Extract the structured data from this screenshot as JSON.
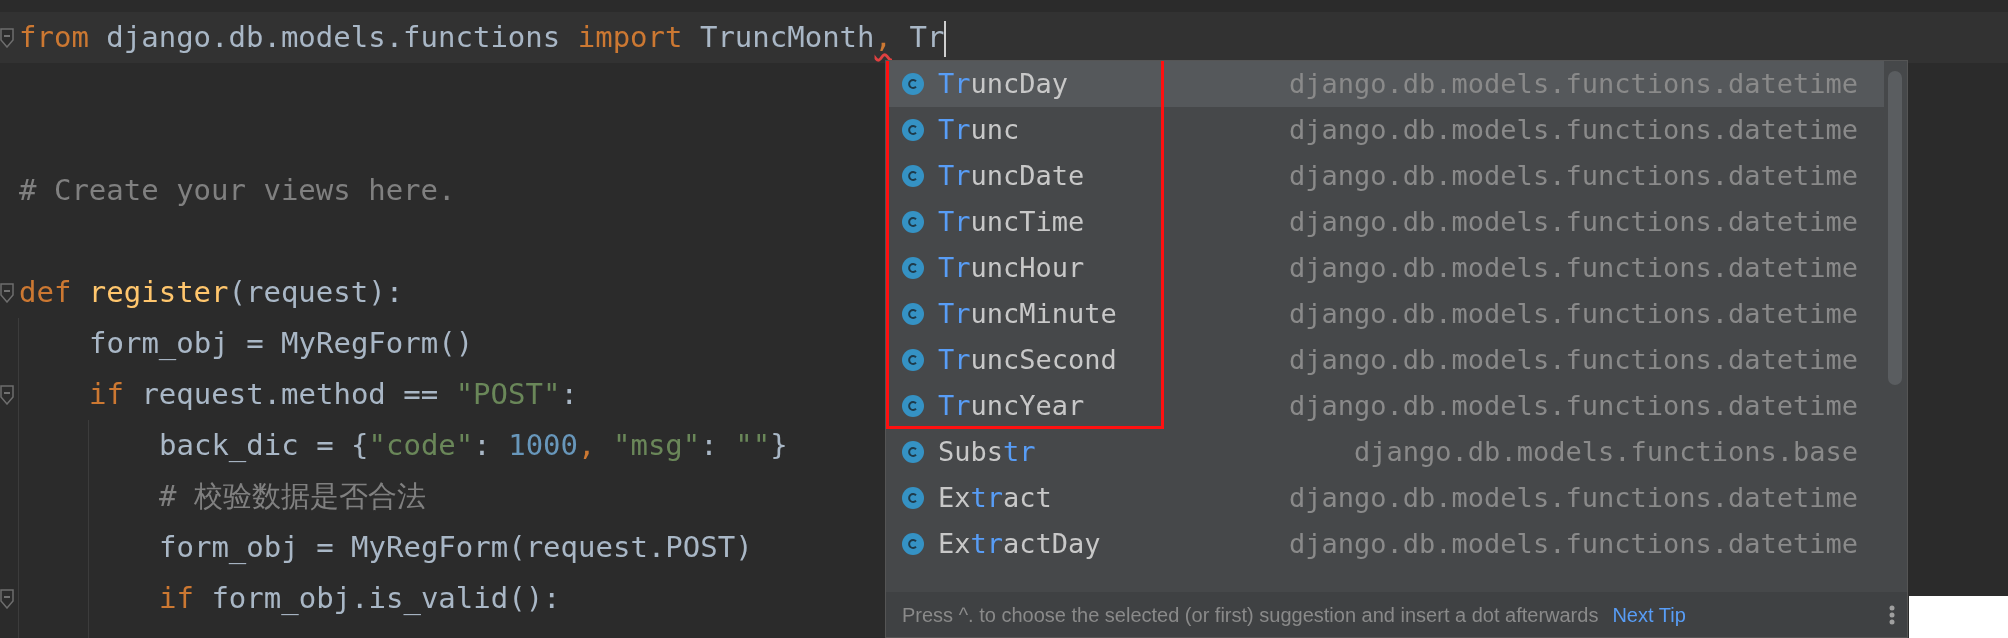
{
  "editor": {
    "lines": [
      {
        "current": true,
        "fold": true,
        "caret": true,
        "tokens": [
          {
            "text": "from",
            "kind": "keyword"
          },
          {
            "text": " django.db.models.functions ",
            "kind": "plain"
          },
          {
            "text": "import",
            "kind": "keyword"
          },
          {
            "text": " TruncMonth",
            "kind": "plain"
          },
          {
            "text": ",",
            "kind": "comma",
            "squiggle": true
          },
          {
            "text": " Tr",
            "kind": "plain"
          }
        ]
      },
      {
        "kind": "blank"
      },
      {
        "kind": "blank"
      },
      {
        "current": false,
        "fold": false,
        "caret": false,
        "tokens": [
          {
            "text": "# Create your views here.",
            "kind": "comment"
          }
        ]
      },
      {
        "kind": "blank"
      },
      {
        "current": false,
        "fold": true,
        "caret": false,
        "tokens": [
          {
            "text": "def ",
            "kind": "keyword"
          },
          {
            "text": "register",
            "kind": "function"
          },
          {
            "text": "(request):",
            "kind": "plain"
          }
        ],
        "children": [
          {
            "current": false,
            "fold": false,
            "caret": false,
            "tokens": [
              {
                "text": "form_obj = MyRegForm()",
                "kind": "plain"
              }
            ]
          },
          {
            "current": false,
            "fold": true,
            "caret": false,
            "tokens": [
              {
                "text": "if",
                "kind": "keyword"
              },
              {
                "text": " request.method == ",
                "kind": "plain"
              },
              {
                "text": "\"POST\"",
                "kind": "string"
              },
              {
                "text": ":",
                "kind": "plain"
              }
            ],
            "children": [
              {
                "current": false,
                "fold": false,
                "caret": false,
                "tokens": [
                  {
                    "text": "back_dic = {",
                    "kind": "plain"
                  },
                  {
                    "text": "\"code\"",
                    "kind": "string"
                  },
                  {
                    "text": ": ",
                    "kind": "plain"
                  },
                  {
                    "text": "1000",
                    "kind": "number"
                  },
                  {
                    "text": ", ",
                    "kind": "comma",
                    "squiggle": false
                  },
                  {
                    "text": "\"msg\"",
                    "kind": "string"
                  },
                  {
                    "text": ": ",
                    "kind": "plain"
                  },
                  {
                    "text": "\"\"",
                    "kind": "string"
                  },
                  {
                    "text": "}",
                    "kind": "plain"
                  }
                ]
              },
              {
                "current": false,
                "fold": false,
                "caret": false,
                "tokens": [
                  {
                    "text": "# 校验数据是否合法",
                    "kind": "comment"
                  }
                ]
              },
              {
                "current": false,
                "fold": false,
                "caret": false,
                "tokens": [
                  {
                    "text": "form_obj = MyRegForm(request.POST)",
                    "kind": "plain"
                  }
                ]
              },
              {
                "current": false,
                "fold": true,
                "caret": false,
                "tokens": [
                  {
                    "text": "if",
                    "kind": "keyword"
                  },
                  {
                    "text": " form_obj.is_valid():",
                    "kind": "plain"
                  }
                ]
              }
            ]
          }
        ]
      }
    ]
  },
  "completion": {
    "sections": [
      {
        "framed": true,
        "items": [
          {
            "selected": true,
            "parts": [
              {
                "text": "Tr",
                "match": true
              },
              {
                "text": "uncDay",
                "match": false
              }
            ],
            "location": "django.db.models.functions.datetime"
          },
          {
            "selected": false,
            "parts": [
              {
                "text": "Tr",
                "match": true
              },
              {
                "text": "unc",
                "match": false
              }
            ],
            "location": "django.db.models.functions.datetime"
          },
          {
            "selected": false,
            "parts": [
              {
                "text": "Tr",
                "match": true
              },
              {
                "text": "uncDate",
                "match": false
              }
            ],
            "location": "django.db.models.functions.datetime"
          },
          {
            "selected": false,
            "parts": [
              {
                "text": "Tr",
                "match": true
              },
              {
                "text": "uncTime",
                "match": false
              }
            ],
            "location": "django.db.models.functions.datetime"
          },
          {
            "selected": false,
            "parts": [
              {
                "text": "Tr",
                "match": true
              },
              {
                "text": "uncHour",
                "match": false
              }
            ],
            "location": "django.db.models.functions.datetime"
          },
          {
            "selected": false,
            "parts": [
              {
                "text": "Tr",
                "match": true
              },
              {
                "text": "uncMinute",
                "match": false
              }
            ],
            "location": "django.db.models.functions.datetime"
          },
          {
            "selected": false,
            "parts": [
              {
                "text": "Tr",
                "match": true
              },
              {
                "text": "uncSecond",
                "match": false
              }
            ],
            "location": "django.db.models.functions.datetime"
          },
          {
            "selected": false,
            "parts": [
              {
                "text": "Tr",
                "match": true
              },
              {
                "text": "uncYear",
                "match": false
              }
            ],
            "location": "django.db.models.functions.datetime"
          }
        ]
      },
      {
        "framed": false,
        "items": [
          {
            "selected": false,
            "parts": [
              {
                "text": "Subs",
                "match": false
              },
              {
                "text": "tr",
                "match": true
              }
            ],
            "location": "django.db.models.functions.base"
          },
          {
            "selected": false,
            "parts": [
              {
                "text": "Ex",
                "match": false
              },
              {
                "text": "tr",
                "match": true
              },
              {
                "text": "act",
                "match": false
              }
            ],
            "location": "django.db.models.functions.datetime"
          },
          {
            "selected": false,
            "parts": [
              {
                "text": "Ex",
                "match": false
              },
              {
                "text": "tr",
                "match": true
              },
              {
                "text": "actDay",
                "match": false
              }
            ],
            "location": "django.db.models.functions.datetime"
          }
        ]
      }
    ],
    "hint": "Press ^. to choose the selected (or first) suggestion and insert a dot afterwards",
    "next_tip": "Next Tip"
  }
}
